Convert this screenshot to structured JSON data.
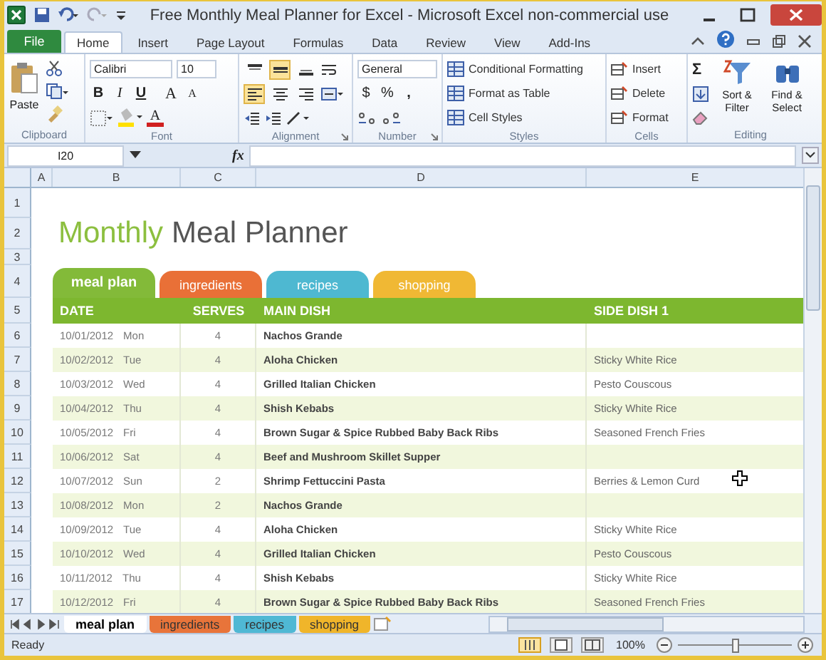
{
  "window": {
    "title": "Free Monthly Meal Planner for Excel  -  Microsoft Excel non-commercial use"
  },
  "ribbon_tabs": [
    {
      "label": "File",
      "kind": "file",
      "selected": false
    },
    {
      "label": "Home",
      "kind": "tab",
      "selected": true
    },
    {
      "label": "Insert",
      "kind": "tab",
      "selected": false
    },
    {
      "label": "Page Layout",
      "kind": "tab",
      "selected": false
    },
    {
      "label": "Formulas",
      "kind": "tab",
      "selected": false
    },
    {
      "label": "Data",
      "kind": "tab",
      "selected": false
    },
    {
      "label": "Review",
      "kind": "tab",
      "selected": false
    },
    {
      "label": "View",
      "kind": "tab",
      "selected": false
    },
    {
      "label": "Add-Ins",
      "kind": "tab",
      "selected": false
    }
  ],
  "ribbon": {
    "clipboard": {
      "paste": "Paste",
      "label": "Clipboard"
    },
    "font": {
      "name": "Calibri",
      "size": "10",
      "bold": "B",
      "italic": "I",
      "underline": "U",
      "grow": "A",
      "shrink": "A",
      "color_letter": "A",
      "label": "Font"
    },
    "alignment": {
      "vertical": [
        {
          "kind": "top",
          "selected": false
        },
        {
          "kind": "middle",
          "selected": true
        },
        {
          "kind": "bottom",
          "selected": false
        }
      ],
      "horizontal": [
        {
          "kind": "left",
          "selected": true
        },
        {
          "kind": "center",
          "selected": false
        },
        {
          "kind": "right",
          "selected": false
        }
      ],
      "label": "Alignment"
    },
    "number": {
      "format": "General",
      "currency": "$",
      "percent": "%",
      "comma": ",",
      "label": "Number"
    },
    "styles": {
      "items": [
        "Conditional Formatting",
        "Format as Table",
        "Cell Styles"
      ],
      "label": "Styles"
    },
    "cells": {
      "items": [
        "Insert",
        "Delete",
        "Format"
      ],
      "label": "Cells"
    },
    "editing": {
      "sum": "Σ",
      "sort": "Sort & Filter",
      "find": "Find & Select",
      "label": "Editing"
    }
  },
  "formula_bar": {
    "name_box": "I20",
    "function_label": "fx"
  },
  "columns": [
    "A",
    "B",
    "C",
    "D",
    "E"
  ],
  "sheet": {
    "title_accent": "Monthly",
    "title_rest": "Meal Planner",
    "nav_tabs": [
      {
        "label": "meal plan",
        "color": "#7db72f",
        "selected": true
      },
      {
        "label": "ingredients",
        "color": "#e8692d",
        "selected": false
      },
      {
        "label": "recipes",
        "color": "#45b5cf",
        "selected": false
      },
      {
        "label": "shopping",
        "color": "#f0b52a",
        "selected": false
      }
    ],
    "headers": [
      "DATE",
      "SERVES",
      "MAIN DISH",
      "SIDE DISH 1"
    ],
    "rows": [
      {
        "number": "6",
        "date": "10/01/2012",
        "day": "Mon",
        "serves": "4",
        "main": "Nachos Grande"
      },
      {
        "number": "7",
        "date": "10/02/2012",
        "day": "Tue",
        "serves": "4",
        "main": "Aloha Chicken",
        "side": "Sticky White Rice"
      },
      {
        "number": "8",
        "date": "10/03/2012",
        "day": "Wed",
        "serves": "4",
        "main": "Grilled Italian Chicken",
        "side": "Pesto Couscous"
      },
      {
        "number": "9",
        "date": "10/04/2012",
        "day": "Thu",
        "serves": "4",
        "main": "Shish Kebabs",
        "side": "Sticky White Rice"
      },
      {
        "number": "10",
        "date": "10/05/2012",
        "day": "Fri",
        "serves": "4",
        "main": "Brown Sugar & Spice Rubbed Baby Back Ribs",
        "side": "Seasoned French Fries"
      },
      {
        "number": "11",
        "date": "10/06/2012",
        "day": "Sat",
        "serves": "4",
        "main": "Beef and Mushroom Skillet Supper"
      },
      {
        "number": "12",
        "date": "10/07/2012",
        "day": "Sun",
        "serves": "2",
        "main": "Shrimp Fettuccini Pasta",
        "side": "Berries & Lemon Curd"
      },
      {
        "number": "13",
        "date": "10/08/2012",
        "day": "Mon",
        "serves": "2",
        "main": "Nachos Grande"
      },
      {
        "number": "14",
        "date": "10/09/2012",
        "day": "Tue",
        "serves": "4",
        "main": "Aloha Chicken",
        "side": "Sticky White Rice"
      },
      {
        "number": "15",
        "date": "10/10/2012",
        "day": "Wed",
        "serves": "4",
        "main": "Grilled Italian Chicken",
        "side": "Pesto Couscous"
      },
      {
        "number": "16",
        "date": "10/11/2012",
        "day": "Thu",
        "serves": "4",
        "main": "Shish Kebabs",
        "side": "Sticky White Rice"
      },
      {
        "number": "17",
        "date": "10/12/2012",
        "day": "Fri",
        "serves": "4",
        "main": "Brown Sugar & Spice Rubbed Baby Back Ribs",
        "side": "Seasoned French Fries"
      }
    ],
    "top_row_numbers": [
      "1",
      "2",
      "3",
      "4",
      "5"
    ]
  },
  "sheet_tabs": [
    {
      "label": "meal plan",
      "color": "#ffffff",
      "selected": true
    },
    {
      "label": "ingredients",
      "color": "#e8743a",
      "selected": false
    },
    {
      "label": "recipes",
      "color": "#4fb8d4",
      "selected": false
    },
    {
      "label": "shopping",
      "color": "#f0b52a",
      "selected": false
    }
  ],
  "status_bar": {
    "status": "Ready",
    "zoom": "100%",
    "zoom_slider": {
      "level": 0.5
    }
  }
}
